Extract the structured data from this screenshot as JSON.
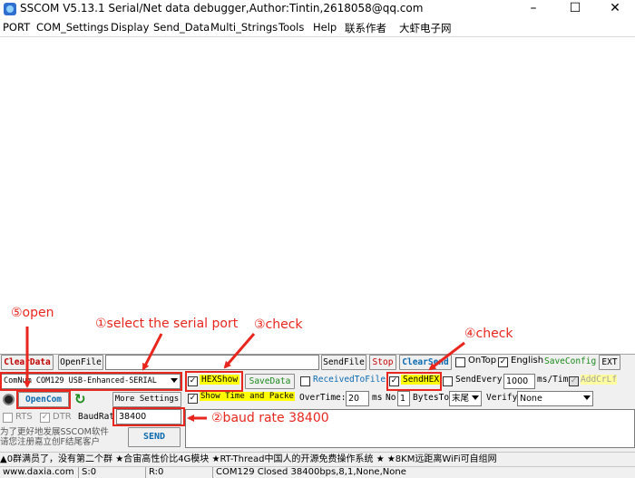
{
  "window": {
    "title": "SSCOM V5.13.1 Serial/Net data debugger,Author:Tintin,2618058@qq.com",
    "minimize_glyph": "–",
    "maximize_glyph": "☐",
    "close_glyph": "✕"
  },
  "menu": [
    "PORT",
    "COM_Settings",
    "Display",
    "Send_Data",
    "Multi_Strings",
    "Tools",
    "Help",
    "联系作者",
    "大虾电子网"
  ],
  "row1": {
    "clear_data": "ClearData",
    "open_file": "OpenFile",
    "send_file": "SendFile",
    "stop": "Stop",
    "clear_send": "ClearSend",
    "on_top": "OnTop",
    "english": "English",
    "save_config": "SaveConfig",
    "ext": "EXT"
  },
  "row2": {
    "com_num_label": "ComNum",
    "com_port": "COM129 USB-Enhanced-SERIAL",
    "hex_show": "HEXShow",
    "save_data": "SaveData",
    "received_to_file": "ReceivedToFile",
    "send_hex": "SendHEX",
    "send_every": "SendEvery:",
    "send_every_value": "1000",
    "ms_tim": "ms/Tim",
    "add_crlf": "AddCrLf"
  },
  "row3": {
    "open_com": "OpenCom",
    "more_settings": "More Settings",
    "show_time_packet": "Show Time and Packe",
    "overtime_label": "OverTime:",
    "overtime_value": "20",
    "ms_label": "ms",
    "no_label": "No",
    "no_value": "1",
    "bytes_to": "BytesTo",
    "tail_value": "末尾",
    "verify_label": "Verify",
    "verify_value": "None"
  },
  "row4": {
    "rts": "RTS",
    "dtr": "DTR",
    "baud_label": "BaudRat",
    "baud_value": "38400"
  },
  "promo_text": "为了更好地发展SSCOM软件\n请您注册嘉立创F结尾客户",
  "send_button": "SEND",
  "ticker": "▲0群满员了，没有第二个群  ★合宙高性价比4G模块  ★RT-Thread中国人的开源免费操作系统  ★  ★8KM远距离WiFi可自组网",
  "status": {
    "site": "www.daxia.com",
    "s": "S:0",
    "r": "R:0",
    "port_state": "COM129 Closed  38400bps,8,1,None,None"
  },
  "annotations": {
    "open": "⑤open",
    "select_port": "①select the serial port",
    "check3": "③check",
    "check4": "④check",
    "baud": "②baud rate 38400"
  },
  "colors": {
    "annotation_red": "#e8261d",
    "highlight_yellow": "#ffff00",
    "open_com_text": "#0a6ab0",
    "green_text": "#1a8a1a"
  }
}
